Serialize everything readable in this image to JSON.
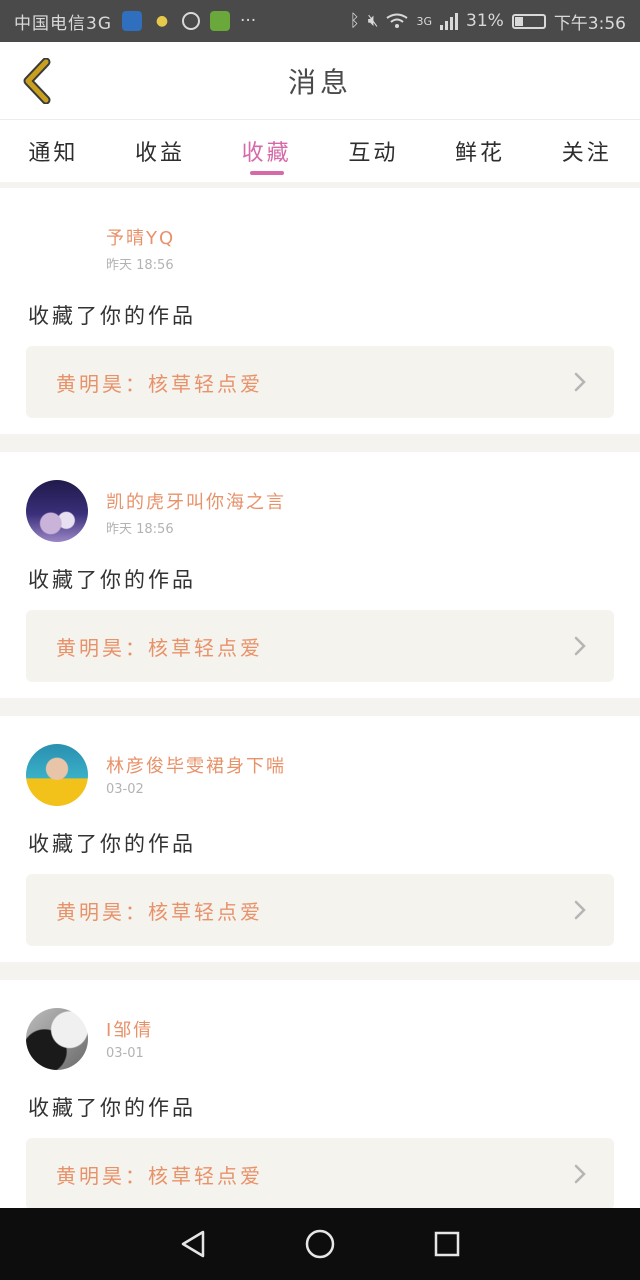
{
  "status_bar": {
    "carrier": "中国电信3G",
    "icons": [
      "shield-app-icon",
      "bulb-app-icon",
      "hex-app-icon",
      "game-app-icon",
      "more-dots-icon",
      "bluetooth-icon",
      "mute-icon",
      "wifi-icon",
      "signal-icon"
    ],
    "network": "3G",
    "battery": "31%",
    "battery_level": 0.31,
    "time": "下午3:56"
  },
  "header": {
    "title": "消息",
    "back_icon": "chevron-left-icon",
    "accent_color": "#c9a01e"
  },
  "tabs": [
    {
      "label": "通知",
      "active": false
    },
    {
      "label": "收益",
      "active": false
    },
    {
      "label": "收藏",
      "active": true
    },
    {
      "label": "互动",
      "active": false
    },
    {
      "label": "鲜花",
      "active": false
    },
    {
      "label": "关注",
      "active": false
    }
  ],
  "accent_pink": "#d66aa8",
  "messages": [
    {
      "user": "予晴YQ",
      "time": "昨天 18:56",
      "action": "收藏了你的作品",
      "work": "黄明昊：核草轻点爱",
      "avatar": "blank"
    },
    {
      "user": "凯的虎牙叫你海之言",
      "time": "昨天 18:56",
      "action": "收藏了你的作品",
      "work": "黄明昊：核草轻点爱",
      "avatar": "crowd"
    },
    {
      "user": "林彦俊毕雯裙身下喘",
      "time": "03-02",
      "action": "收藏了你的作品",
      "work": "黄明昊：核草轻点爱",
      "avatar": "yellow"
    },
    {
      "user": "I邹倩",
      "time": "03-01",
      "action": "收藏了你的作品",
      "work": "黄明昊：核草轻点爱",
      "avatar": "mono"
    }
  ],
  "navbar": {
    "buttons": [
      "back-triangle-icon",
      "home-circle-icon",
      "recents-square-icon"
    ]
  }
}
